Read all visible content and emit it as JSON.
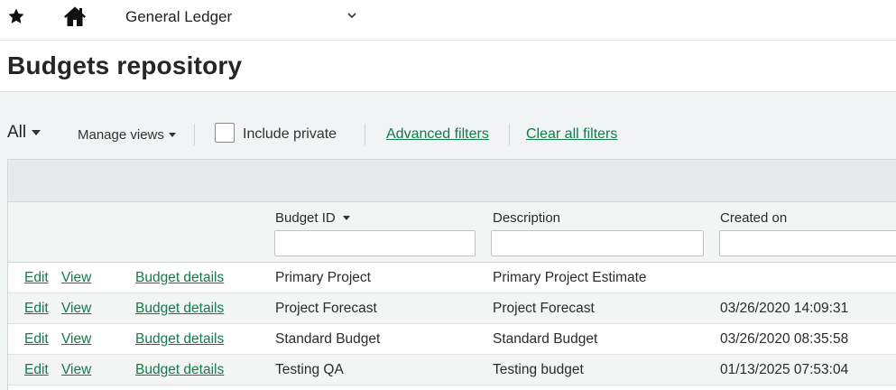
{
  "app": {
    "module_title": "General Ledger",
    "icons": {
      "favorite": "star-icon",
      "home": "home-icon",
      "module_menu": "chevron-down-icon"
    }
  },
  "page": {
    "title": "Budgets repository"
  },
  "toolbar": {
    "view_selector": "All",
    "manage_views": "Manage views",
    "include_private": "Include private",
    "include_private_checked": false,
    "advanced_filters": "Advanced filters",
    "clear_all_filters": "Clear all filters"
  },
  "grid": {
    "columns": [
      {
        "label": "Budget ID",
        "sorted": true
      },
      {
        "label": "Description"
      },
      {
        "label": "Created on"
      }
    ],
    "filters": {
      "budget_id": "",
      "description": "",
      "created_on": ""
    },
    "actions": {
      "edit": "Edit",
      "view": "View",
      "details": "Budget details"
    },
    "rows": [
      {
        "budget_id": "Primary Project",
        "description": "Primary Project Estimate",
        "created_on": ""
      },
      {
        "budget_id": "Project Forecast",
        "description": "Project Forecast",
        "created_on": "03/26/2020 14:09:31"
      },
      {
        "budget_id": "Standard Budget",
        "description": "Standard Budget",
        "created_on": "03/26/2020 08:35:58"
      },
      {
        "budget_id": "Testing QA",
        "description": "Testing budget",
        "created_on": "01/13/2025 07:53:04"
      }
    ]
  },
  "colors": {
    "link": "#147a4a",
    "header_band": "#e6eaea",
    "page_bg": "#f1f4f4"
  }
}
